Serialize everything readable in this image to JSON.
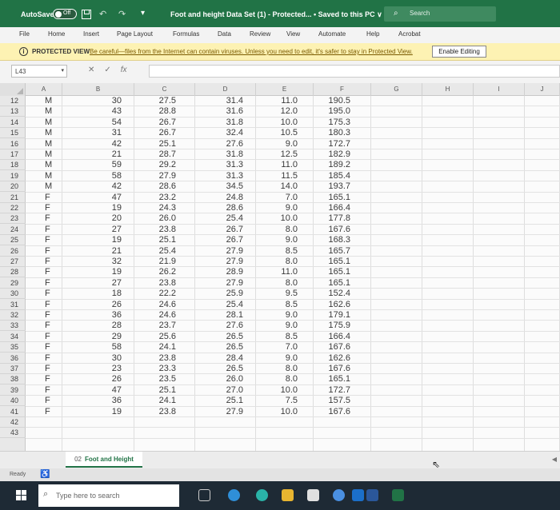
{
  "titlebar": {
    "autosave_label": "AutoSave",
    "autosave_state": "Off",
    "doc_title": "Foot and height Data Set (1)  -  Protected...  •  Saved to this PC ∨",
    "search_placeholder": "Search"
  },
  "ribbon": {
    "tabs": [
      "File",
      "Home",
      "Insert",
      "Page Layout",
      "Formulas",
      "Data",
      "Review",
      "View",
      "Automate",
      "Help",
      "Acrobat"
    ]
  },
  "protected_view": {
    "title": "PROTECTED VIEW",
    "message": "Be careful—files from the Internet can contain viruses. Unless you need to edit, it's safer to stay in Protected View.",
    "enable_button": "Enable Editing"
  },
  "formula_bar": {
    "name_box": "L43",
    "fx_label": "fx",
    "content": ""
  },
  "grid": {
    "columns": [
      "A",
      "B",
      "C",
      "D",
      "E",
      "F",
      "G",
      "H",
      "I",
      "J"
    ],
    "row_numbers": [
      12,
      13,
      14,
      15,
      16,
      17,
      18,
      19,
      20,
      21,
      22,
      23,
      24,
      25,
      26,
      27,
      28,
      29,
      30,
      31,
      32,
      33,
      34,
      35,
      36,
      37,
      38,
      39,
      40,
      41,
      42,
      43
    ],
    "rows": [
      [
        "M",
        "30",
        "27.5",
        "31.4",
        "11.0",
        "190.5"
      ],
      [
        "M",
        "43",
        "28.8",
        "31.6",
        "12.0",
        "195.0"
      ],
      [
        "M",
        "54",
        "26.7",
        "31.8",
        "10.0",
        "175.3"
      ],
      [
        "M",
        "31",
        "26.7",
        "32.4",
        "10.5",
        "180.3"
      ],
      [
        "M",
        "42",
        "25.1",
        "27.6",
        "9.0",
        "172.7"
      ],
      [
        "M",
        "21",
        "28.7",
        "31.8",
        "12.5",
        "182.9"
      ],
      [
        "M",
        "59",
        "29.2",
        "31.3",
        "11.0",
        "189.2"
      ],
      [
        "M",
        "58",
        "27.9",
        "31.3",
        "11.5",
        "185.4"
      ],
      [
        "M",
        "42",
        "28.6",
        "34.5",
        "14.0",
        "193.7"
      ],
      [
        "F",
        "47",
        "23.2",
        "24.8",
        "7.0",
        "165.1"
      ],
      [
        "F",
        "19",
        "24.3",
        "28.6",
        "9.0",
        "166.4"
      ],
      [
        "F",
        "20",
        "26.0",
        "25.4",
        "10.0",
        "177.8"
      ],
      [
        "F",
        "27",
        "23.8",
        "26.7",
        "8.0",
        "167.6"
      ],
      [
        "F",
        "19",
        "25.1",
        "26.7",
        "9.0",
        "168.3"
      ],
      [
        "F",
        "21",
        "25.4",
        "27.9",
        "8.5",
        "165.7"
      ],
      [
        "F",
        "32",
        "21.9",
        "27.9",
        "8.0",
        "165.1"
      ],
      [
        "F",
        "19",
        "26.2",
        "28.9",
        "11.0",
        "165.1"
      ],
      [
        "F",
        "27",
        "23.8",
        "27.9",
        "8.0",
        "165.1"
      ],
      [
        "F",
        "18",
        "22.2",
        "25.9",
        "9.5",
        "152.4"
      ],
      [
        "F",
        "26",
        "24.6",
        "25.4",
        "8.5",
        "162.6"
      ],
      [
        "F",
        "36",
        "24.6",
        "28.1",
        "9.0",
        "179.1"
      ],
      [
        "F",
        "28",
        "23.7",
        "27.6",
        "9.0",
        "175.9"
      ],
      [
        "F",
        "29",
        "25.6",
        "26.5",
        "8.5",
        "166.4"
      ],
      [
        "F",
        "58",
        "24.1",
        "26.5",
        "7.0",
        "167.6"
      ],
      [
        "F",
        "30",
        "23.8",
        "28.4",
        "9.0",
        "162.6"
      ],
      [
        "F",
        "23",
        "23.3",
        "26.5",
        "8.0",
        "167.6"
      ],
      [
        "F",
        "26",
        "23.5",
        "26.0",
        "8.0",
        "165.1"
      ],
      [
        "F",
        "47",
        "25.1",
        "27.0",
        "10.0",
        "172.7"
      ],
      [
        "F",
        "36",
        "24.1",
        "25.1",
        "7.5",
        "157.5"
      ],
      [
        "F",
        "19",
        "23.8",
        "27.9",
        "10.0",
        "167.6"
      ]
    ]
  },
  "sheet_tab": {
    "prefix": "02",
    "name": "Foot and Height"
  },
  "status": {
    "ready": "Ready"
  },
  "taskbar": {
    "search_placeholder": "Type here to search"
  },
  "colors": {
    "excel_green": "#217346",
    "protected_bar": "#fdf2b3"
  }
}
